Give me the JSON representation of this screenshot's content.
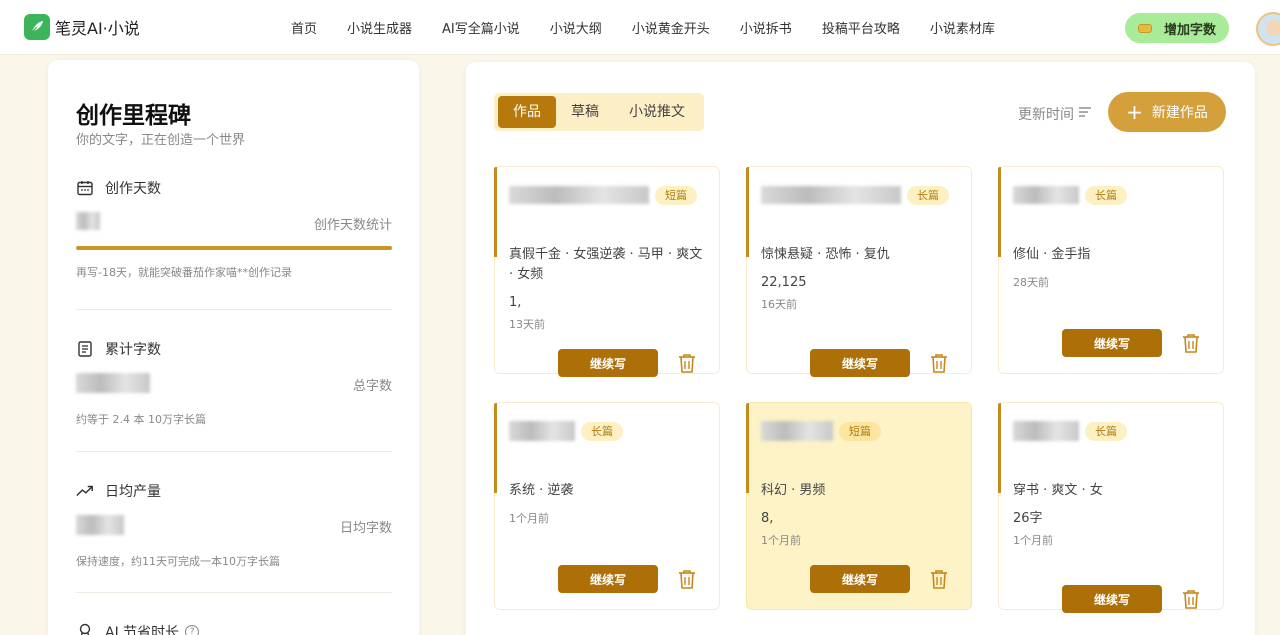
{
  "brand": {
    "name": "笔灵AI·小说"
  },
  "nav": [
    "首页",
    "小说生成器",
    "AI写全篇小说",
    "小说大纲",
    "小说黄金开头",
    "小说拆书",
    "投稿平台攻略",
    "小说素材库"
  ],
  "header": {
    "add_words_label": "增加字数"
  },
  "milestone": {
    "title": "创作里程碑",
    "subtitle": "你的文字，正在创造一个世界",
    "days": {
      "label": "创作天数",
      "right": "创作天数统计",
      "note": "再写-18天，就能突破番茄作家喵**创作记录",
      "progress": 1.0
    },
    "total": {
      "label": "累计字数",
      "right": "总字数",
      "note": "约等于 2.4 本 10万字长篇"
    },
    "daily": {
      "label": "日均产量",
      "right": "日均字数",
      "note": "保持速度，约11天可完成一本10万字长篇"
    },
    "ai": {
      "label": "AI 节省时长"
    }
  },
  "works": {
    "tabs": [
      "作品",
      "草稿",
      "小说推文"
    ],
    "sort_label": "更新时间",
    "new_label": "新建作品",
    "continue_label": "继续写",
    "cards": [
      {
        "badge": "短篇",
        "tags": "真假千金 · 女强逆袭 · 马甲 · 爽文 · 女频",
        "words": "1,",
        "time": "13天前"
      },
      {
        "badge": "长篇",
        "tags": "惊悚悬疑 · 恐怖 · 复仇",
        "words": "22,125",
        "time": "16天前"
      },
      {
        "badge": "长篇",
        "tags": "修仙 · 金手指",
        "words": "",
        "time": "28天前"
      },
      {
        "badge": "长篇",
        "tags": "系统 · 逆袭",
        "words": "",
        "time": "1个月前"
      },
      {
        "badge": "短篇",
        "tags": "科幻 · 男频",
        "words": "8,",
        "time": "1个月前"
      },
      {
        "badge": "长篇",
        "tags": "穿书 · 爽文 · 女",
        "words": "26字",
        "time": "1个月前"
      }
    ]
  }
}
